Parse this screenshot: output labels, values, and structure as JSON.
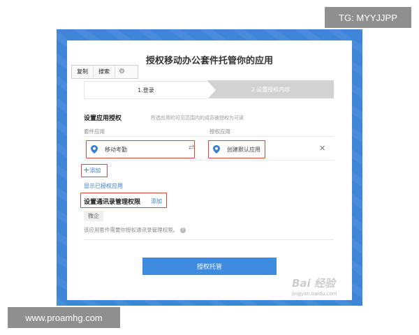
{
  "overlay": {
    "tg_label": "TG: MYYJJPP",
    "site_label": "www.proamhg.com"
  },
  "dialog": {
    "title": "授权移动办公套件托管你的应用",
    "toolbar": {
      "copy": "复制",
      "search": "搜索"
    },
    "steps": [
      {
        "label": "1.登录"
      },
      {
        "label": "2.设置授权内容"
      }
    ],
    "app_auth": {
      "title": "设置应用授权",
      "hint": "所选应用的可见范围内的成员被授权为可读",
      "col_suite": "套件应用",
      "col_auth": "授权应用",
      "suite_app": "移动考勤",
      "auth_app": "创建默认应用",
      "add_label": "添加",
      "show_authorized": "显示已授权应用"
    },
    "contacts": {
      "title": "设置通讯录管理权限",
      "add_label": "添加",
      "tag": "微企",
      "note": "该应用套件需要你授权通讯录管理权限。"
    },
    "primary_button": "授权托管"
  },
  "watermark": {
    "logo": "Bai 经验",
    "url": "jingyan.baidu.com"
  },
  "colors": {
    "frame_blue": "#3f86d9",
    "primary": "#3e8be0",
    "highlight_red": "#d9473d",
    "link_blue": "#3a7fd0"
  }
}
